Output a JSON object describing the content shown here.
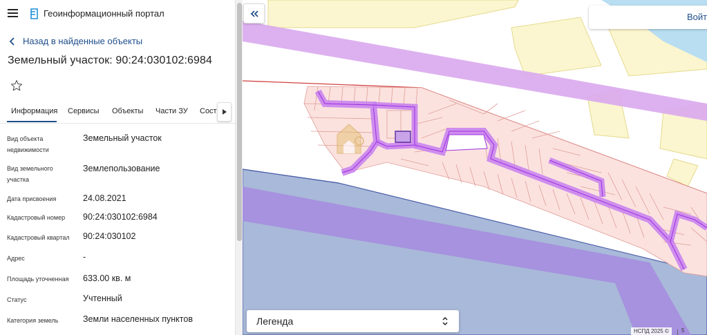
{
  "app": {
    "title": "Геоинформационный портал"
  },
  "navigation": {
    "back_label": "Назад в найденные объекты"
  },
  "object": {
    "title": "Земельный участок: 90:24:030102:6984"
  },
  "tabs": [
    {
      "label": "Информация",
      "active": true
    },
    {
      "label": "Сервисы",
      "active": false
    },
    {
      "label": "Объекты",
      "active": false
    },
    {
      "label": "Части ЗУ",
      "active": false
    },
    {
      "label": "Соста",
      "active": false
    }
  ],
  "properties": [
    {
      "key": "Вид объекта недвижимости",
      "value": "Земельный участок"
    },
    {
      "key": "Вид земельного участка",
      "value": "Землепользование"
    },
    {
      "key": "Дата присвоения",
      "value": "24.08.2021"
    },
    {
      "key": "Кадастровый номер",
      "value": "90:24:030102:6984"
    },
    {
      "key": "Кадастровый квартал",
      "value": "90:24:030102"
    },
    {
      "key": "Адрес",
      "value": "-"
    },
    {
      "key": "Площадь уточненная",
      "value": "633.00 кв. м"
    },
    {
      "key": "Статус",
      "value": "Учтенный"
    },
    {
      "key": "Категория земель",
      "value": "Земли населенных пунктов"
    }
  ],
  "map": {
    "login_label": "Войти",
    "legend_label": "Легенда",
    "attribution": "НСПД 2025 ©",
    "scale_label": "5",
    "colors": {
      "background": "#ffffff",
      "zone_yellow": "#fbf6cf",
      "water": "#b9def2",
      "lilac_band": "#d9a9ee",
      "blue_zone": "#a9b9d9",
      "purple_band": "#b78fe3",
      "parcel_fill": "#fbe2df",
      "parcel_stroke": "#df9c96",
      "road_fill": "#c77ff0",
      "road_stroke": "#9a2fe0",
      "selected_parcel": "#7a3ec8",
      "boundary_red": "#d24040",
      "boundary_blue": "#4b5fa8"
    }
  },
  "colors": {
    "accent": "#1f4e8c",
    "tab_underline": "#1f4e8c"
  }
}
